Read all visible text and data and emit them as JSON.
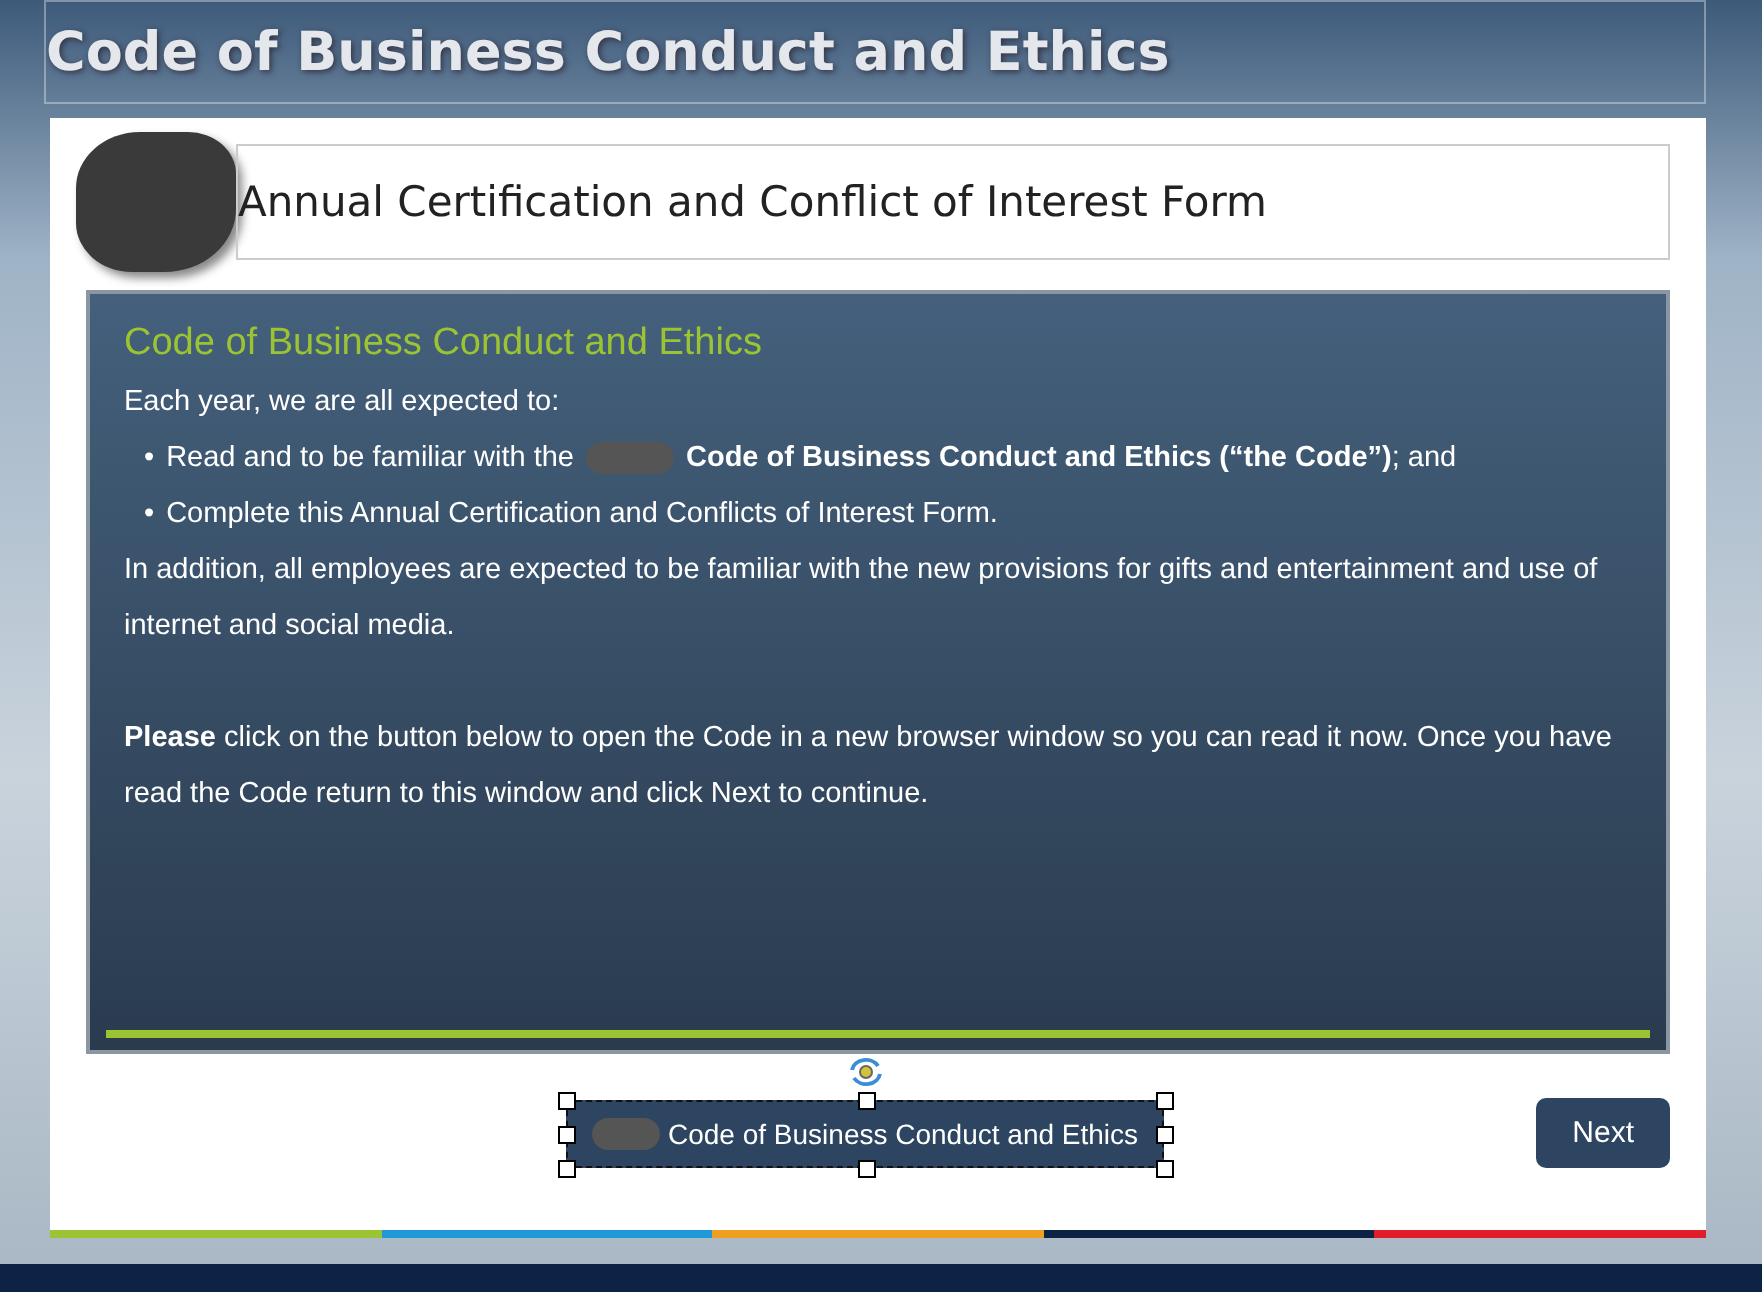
{
  "header": {
    "title": "Code of Business Conduct and Ethics"
  },
  "form_title": "Annual Certification and Conflict of Interest Form",
  "panel": {
    "heading": "Code of Business Conduct and Ethics",
    "intro": "Each year, we are all expected to:",
    "bullets": [
      {
        "marker": "•",
        "parts": [
          "Read and to be familiar with the",
          "**Code of Business Conduct and Ethics (“the Code”)**; and"
        ]
      },
      {
        "marker": "•",
        "parts": [
          "Complete this Annual Certification and Conflicts of Interest Form."
        ]
      }
    ],
    "paragraphs": [
      "In addition, all employees are expected to be familiar with the new provisions for gifts and entertainment and use of internet and social media.",
      "**Please** click on the button below to open the Code in a new browser window so you can read it now. Once you have read the Code return to this window and click Next to continue."
    ]
  },
  "buttons": {
    "code_link": "Code of Business Conduct and Ethics",
    "next": "Next"
  }
}
